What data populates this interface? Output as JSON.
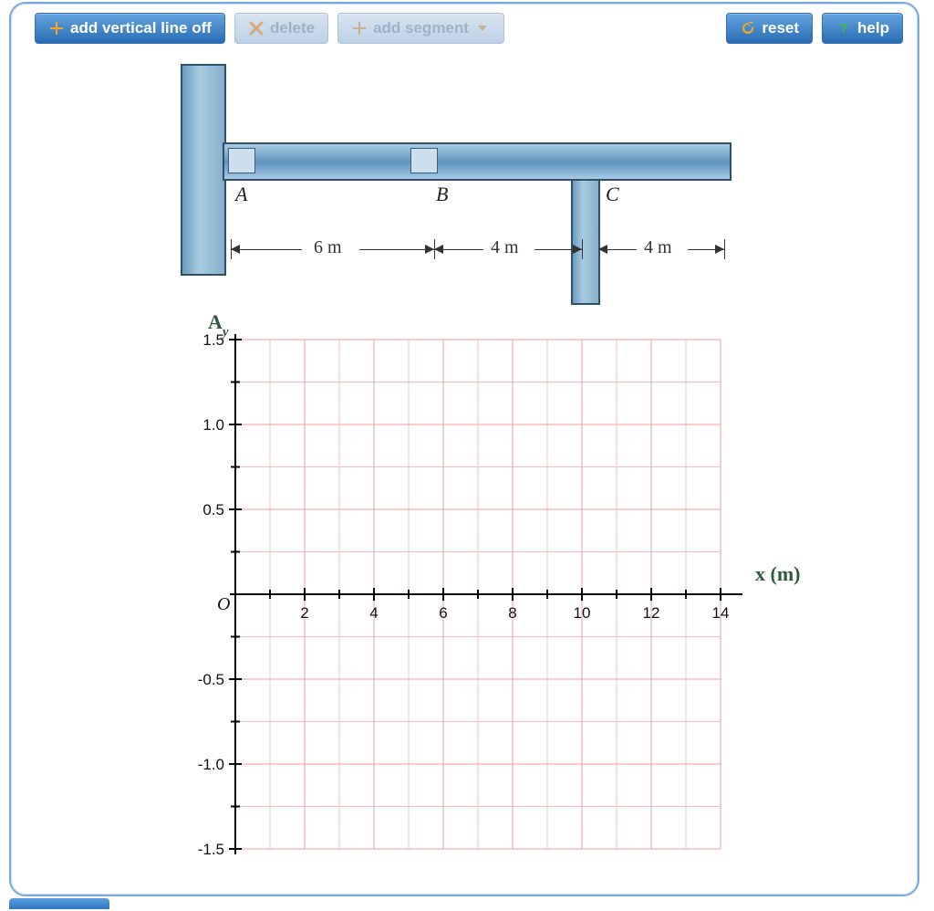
{
  "toolbar": {
    "add_vline": "add vertical line off",
    "delete": "delete",
    "add_segment": "add segment",
    "reset": "reset",
    "help": "help"
  },
  "beam": {
    "pointA": "A",
    "pointB": "B",
    "pointC": "C",
    "dimAB": "6 m",
    "dimBC": "4 m",
    "dimCEnd": "4 m"
  },
  "chart_data": {
    "type": "scatter",
    "title": "",
    "xlabel": "x (m)",
    "ylabel_html": "A_y",
    "origin_label": "O",
    "xlim": [
      0,
      14
    ],
    "ylim": [
      -1.5,
      1.5
    ],
    "xticks": [
      2,
      4,
      6,
      8,
      10,
      12,
      14
    ],
    "yticks": [
      1.5,
      1.0,
      0.5,
      -0.5,
      -1.0,
      -1.5
    ],
    "xticklabels": [
      "2",
      "4",
      "6",
      "8",
      "10",
      "12",
      "14"
    ],
    "yticklabels": [
      "1.5",
      "1.0",
      "0.5",
      "-0.5",
      "-1.0",
      "-1.5"
    ],
    "x_minor_step": 1,
    "y_minor_step": 0.25,
    "series": []
  }
}
